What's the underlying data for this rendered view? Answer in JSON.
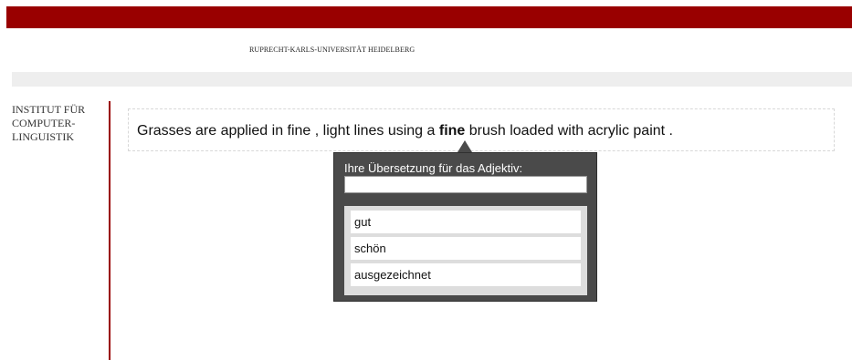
{
  "header": {
    "university": "RUPRECHT-KARLS-UNIVERSITÄT HEIDELBERG"
  },
  "sidebar": {
    "institute_lines": [
      "INSTITUT FÜR",
      "COMPUTER-",
      "LINGUISTIK"
    ]
  },
  "sentence": {
    "before": "Grasses are applied in fine , light lines using a ",
    "highlight": "fine",
    "after": " brush loaded with acrylic paint ."
  },
  "popup": {
    "label": "Ihre Übersetzung für das Adjektiv:",
    "input_value": "",
    "suggestions": [
      "gut",
      "schön",
      "ausgezeichnet"
    ]
  },
  "colors": {
    "brand_red": "#990000",
    "popup_bg": "#4a4a4a"
  }
}
